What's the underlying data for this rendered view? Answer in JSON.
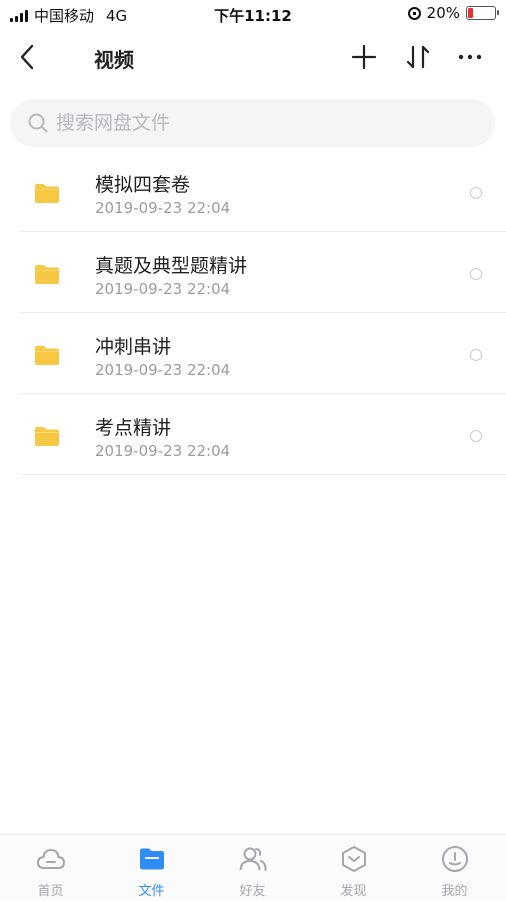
{
  "status_bar": {
    "carrier": "中国移动",
    "network": "4G",
    "time": "下午11:12",
    "battery_percent": "20%",
    "battery_level": 0.2,
    "battery_color": "#e8322f"
  },
  "nav": {
    "title": "视频",
    "back_icon": "chevron-left-icon",
    "actions": [
      "plus-icon",
      "sort-icon",
      "more-icon"
    ]
  },
  "search": {
    "placeholder": "搜索网盘文件",
    "value": ""
  },
  "files": [
    {
      "name": "模拟四套卷",
      "date": "2019-09-23 22:04",
      "icon": "folder-icon"
    },
    {
      "name": "真题及典型题精讲",
      "date": "2019-09-23 22:04",
      "icon": "folder-icon"
    },
    {
      "name": "冲刺串讲",
      "date": "2019-09-23 22:04",
      "icon": "folder-icon"
    },
    {
      "name": "考点精讲",
      "date": "2019-09-23 22:04",
      "icon": "folder-icon"
    }
  ],
  "tabs": [
    {
      "label": "首页",
      "icon": "cloud-home-icon",
      "active": false
    },
    {
      "label": "文件",
      "icon": "folder-tab-icon",
      "active": true
    },
    {
      "label": "好友",
      "icon": "friends-icon",
      "active": false
    },
    {
      "label": "发现",
      "icon": "discover-icon",
      "active": false
    },
    {
      "label": "我的",
      "icon": "profile-icon",
      "active": false
    }
  ],
  "colors": {
    "accent": "#2f8cf2",
    "folder": "#f7c843",
    "inactive_tab": "#a3a6ad"
  }
}
